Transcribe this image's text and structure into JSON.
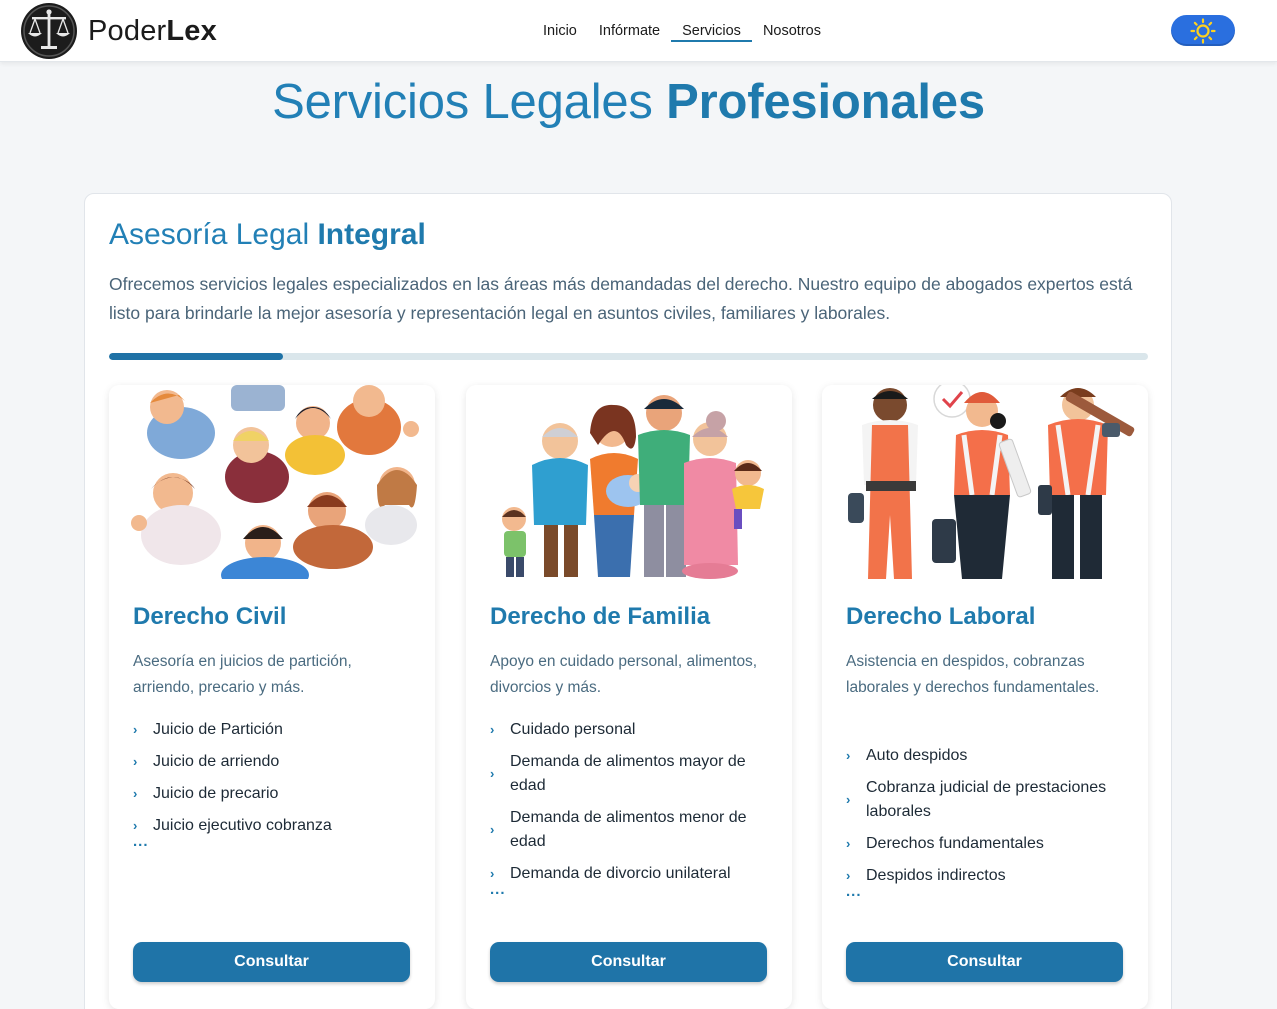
{
  "header": {
    "brand_light": "Poder",
    "brand_bold": "Lex",
    "nav": [
      {
        "label": "Inicio",
        "active": false
      },
      {
        "label": "Infórmate",
        "active": false
      },
      {
        "label": "Servicios",
        "active": true
      },
      {
        "label": "Nosotros",
        "active": false
      }
    ],
    "theme_toggle_icon": "sun-icon",
    "accent_color": "#1f7aad"
  },
  "page": {
    "title_light": "Servicios Legales ",
    "title_bold": "Profesionales"
  },
  "section": {
    "title_light": "Asesoría Legal ",
    "title_bold": "Integral",
    "description": "Ofrecemos servicios legales especializados en las áreas más demandadas del derecho. Nuestro equipo de abogados expertos está listo para brindarle la mejor asesoría y representación legal en asuntos civiles, familiares y laborales.",
    "progress": 0.167
  },
  "cards": [
    {
      "title": "Derecho Civil",
      "description": "Asesoría en juicios de partición, arriendo, precario y más.",
      "items": [
        "Juicio de Partición",
        "Juicio de arriendo",
        "Juicio de precario",
        "Juicio ejecutivo cobranza"
      ],
      "more": "...",
      "button": "Consultar"
    },
    {
      "title": "Derecho de Familia",
      "description": "Apoyo en cuidado personal, alimentos, divorcios y más.",
      "items": [
        "Cuidado personal",
        "Demanda de alimentos mayor de edad",
        "Demanda de alimentos menor de edad",
        "Demanda de divorcio unilateral"
      ],
      "more": "...",
      "button": "Consultar"
    },
    {
      "title": "Derecho Laboral",
      "description": "Asistencia en despidos, cobranzas laborales y derechos fundamentales.",
      "items": [
        "Auto despidos",
        "Cobranza judicial de prestaciones laborales",
        "Derechos fundamentales",
        "Despidos indirectos"
      ],
      "more": "...",
      "button": "Consultar"
    }
  ]
}
